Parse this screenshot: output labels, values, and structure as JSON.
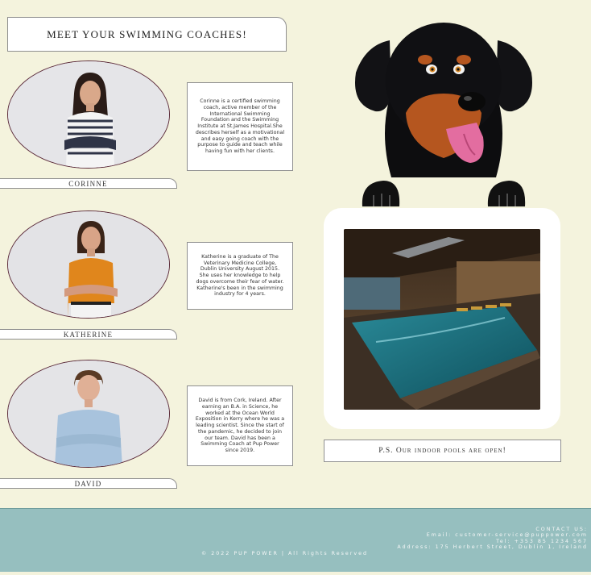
{
  "page": {
    "title": "MEET YOUR SWIMMING COACHES!"
  },
  "coaches": [
    {
      "name": "CORINNE",
      "bio": "Corinne is a certified swimming coach, active member of the International Swimming Foundation and the Swimming Institute at St.James Hospital.She describes herself as a motivational and easy going coach with the purpose to guide and teach while having fun with her clients.",
      "shirt_color": "#2f3447"
    },
    {
      "name": "KATHERINE",
      "bio": "Katherine is a graduate of The Veterinary Medicine College, Dublin University August 2015. She uses her knowledge to help dogs overcome their fear of water. Katherine's been in the swimming industry for 4 years.",
      "shirt_color": "#e0861c"
    },
    {
      "name": "DAVID",
      "bio": "David is from Cork, Ireland. After earning an B.A. in Science, he worked at the Ocean World Exposition in Kerry where he was a leading scientist. Since the start of the pandemic, he decided to join our team. David has been a Swimming Coach at Pup Power since 2019.",
      "shirt_color": "#a8c3dd"
    }
  ],
  "promo": {
    "ps_text": "P.S. Our indoor pools are open!"
  },
  "footer": {
    "contact_heading": "CONTACT US:",
    "email": "Email: customer-service@puppower.com",
    "tel": "Tel: +353 85 1234 567",
    "address": "Address: 175 Herbert Street, Dublin 1, Ireland",
    "copyright": "© 2022 PUP POWER | All Rights Reserved"
  },
  "colors": {
    "background": "#f4f3dd",
    "footer": "#96bfbf",
    "oval_border": "#5b2a3a"
  }
}
